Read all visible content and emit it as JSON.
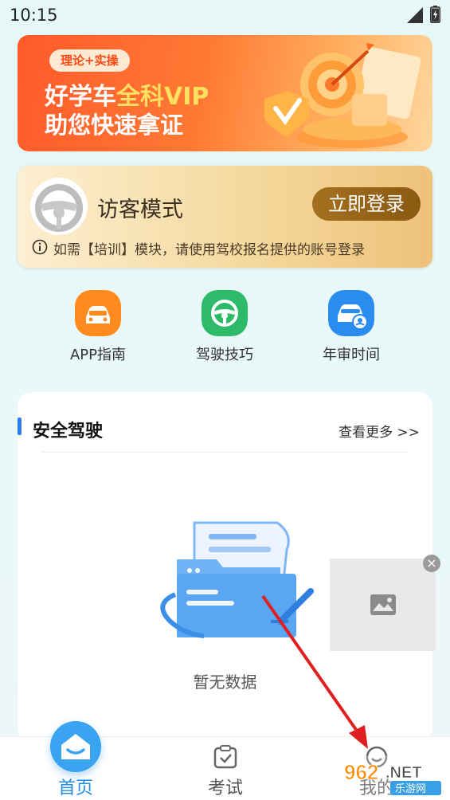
{
  "status_bar": {
    "time": "10:15",
    "icons": [
      "signal-icon",
      "battery-icon"
    ]
  },
  "banner": {
    "tag": "理论+实操",
    "line1_prefix": "好学车",
    "line1_highlight": "全科VIP",
    "line2": "助您快速拿证",
    "colors": {
      "start": "#ff5a2a",
      "end": "#ffd7a0",
      "highlight": "#ffe060"
    }
  },
  "guest": {
    "title": "访客模式",
    "login_button": "立即登录",
    "note": "如需【培训】模块，请使用驾校报名提供的账号登录",
    "icons": [
      "steering-wheel-avatar-icon",
      "info-icon"
    ]
  },
  "quick_links": [
    {
      "label": "APP指南",
      "icon": "car-icon",
      "color": "#ff8a1e"
    },
    {
      "label": "驾驶技巧",
      "icon": "steering-wheel-icon",
      "color": "#2dbb6a"
    },
    {
      "label": "年审时间",
      "icon": "car-inspection-icon",
      "color": "#2b8cf0"
    }
  ],
  "section": {
    "title": "安全驾驶",
    "more": "查看更多 >>",
    "empty_text": "暂无数据",
    "accent": "#2a7bf6"
  },
  "ad": {
    "icon": "image-placeholder-icon",
    "close": "×"
  },
  "tabbar": {
    "tabs": [
      {
        "label": "首页",
        "icon": "home-face-icon",
        "active": true
      },
      {
        "label": "考试",
        "icon": "checkbox-icon",
        "active": false
      },
      {
        "label": "我的",
        "icon": "profile-icon",
        "active": false
      }
    ],
    "active_color": "#1e8ee6"
  },
  "watermark": {
    "logo_text": "962.NET",
    "sub_text": "乐游网"
  }
}
